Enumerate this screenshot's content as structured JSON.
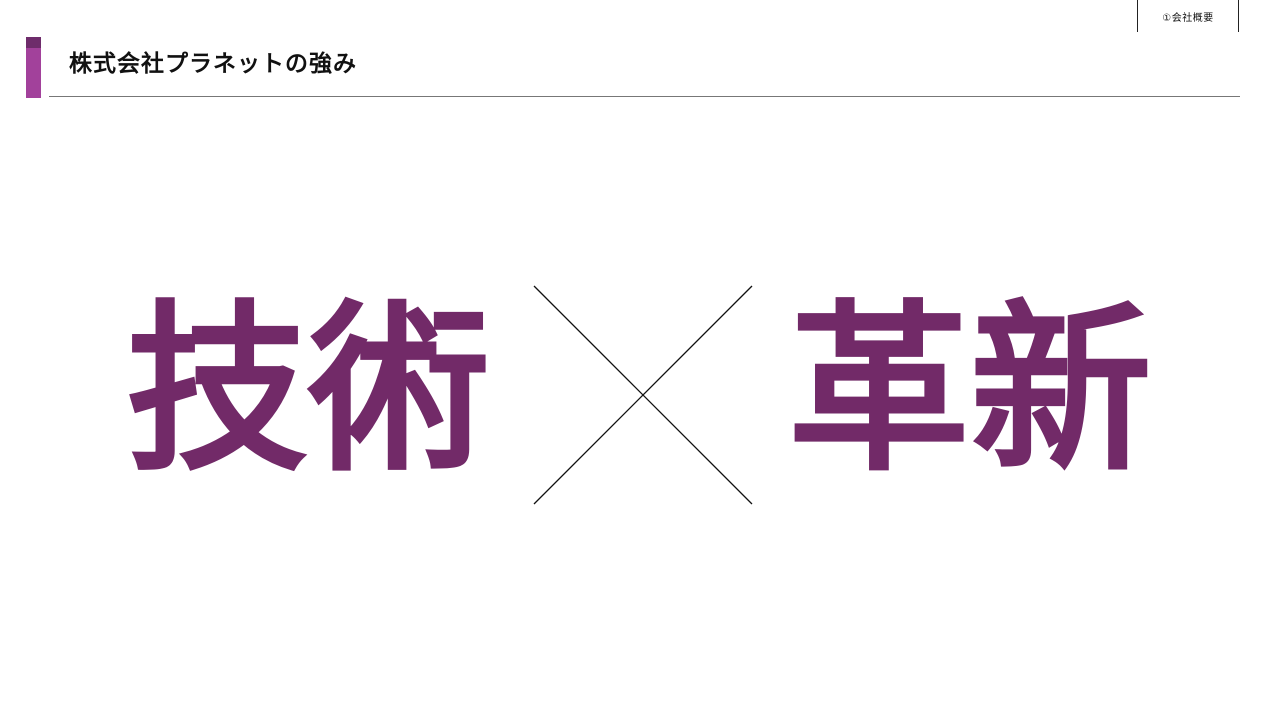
{
  "header": {
    "section_label": "①会社概要",
    "title": "株式会社プラネットの強み"
  },
  "main": {
    "left_word": "技術",
    "right_word": "革新"
  },
  "colors": {
    "accent": "#a2419b",
    "accent_dark": "#6e2c6b",
    "word": "#722a68",
    "cross_line": "#111111"
  }
}
